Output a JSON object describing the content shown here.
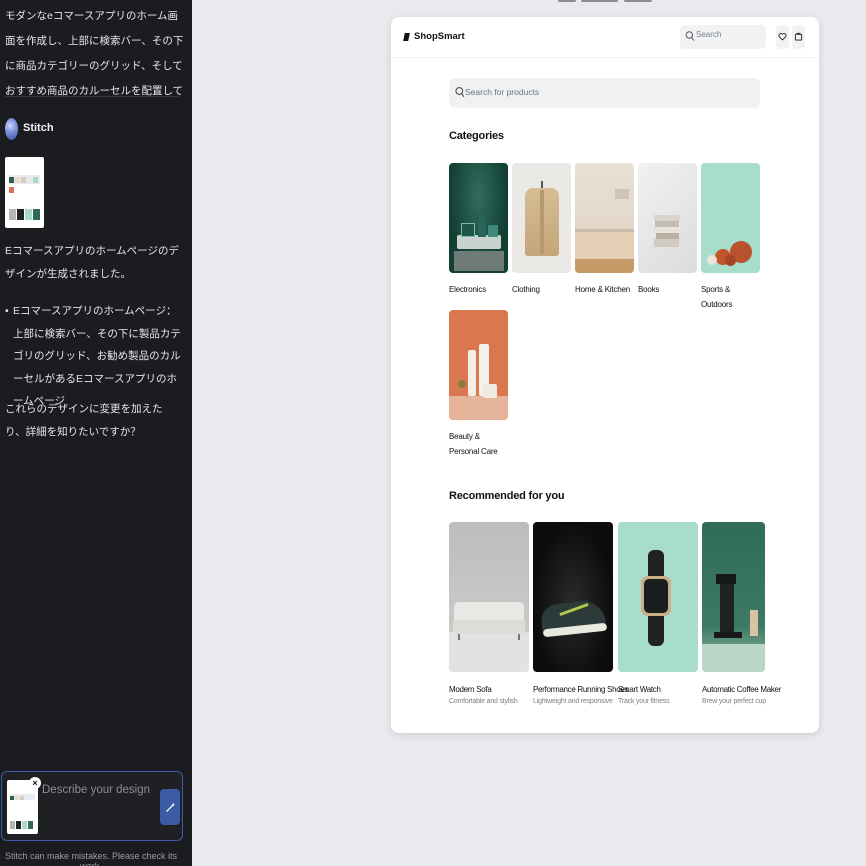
{
  "chat": {
    "prompt": "モダンなeコマースアプリのホーム画面を作成し、上部に検索バー、その下に商品カテゴリーのグリッド、そしておすすめ商品のカルーセルを配置して",
    "agent_name": "Stitch",
    "response_intro": "Eコマースアプリのホームページのデザインが生成されました。",
    "response_item": "Eコマースアプリのホームページ：上部に検索バー、その下に製品カテゴリのグリッド、お勧め製品のカルーセルがあるEコマースアプリのホームページ",
    "response_question": "これらのデザインに変更を加えたり、詳細を知りたいですか？",
    "input_placeholder": "Describe your design",
    "disclaimer": "Stitch can make mistakes. Please check its work."
  },
  "app": {
    "brand": "ShopSmart",
    "header_search_placeholder": "Search",
    "main_search_placeholder": "Search for products",
    "categories_title": "Categories",
    "categories": [
      {
        "label": "Electronics"
      },
      {
        "label": "Clothing"
      },
      {
        "label": "Home & Kitchen"
      },
      {
        "label": "Books"
      },
      {
        "label": "Sports & Outdoors"
      },
      {
        "label": "Beauty & Personal Care"
      }
    ],
    "recommended_title": "Recommended for you",
    "products": [
      {
        "name": "Modern Sofa",
        "desc": "Comfortable and stylish"
      },
      {
        "name": "Performance Running Shoes",
        "desc": "Lightweight and responsive"
      },
      {
        "name": "Smart Watch",
        "desc": "Track your fitness"
      },
      {
        "name": "Automatic Coffee Maker",
        "desc": "Brew your perfect cup"
      }
    ]
  },
  "icons": {
    "header": [
      "search-icon",
      "heart-icon",
      "cart-icon"
    ],
    "composer": [
      "close-icon",
      "magic-wand-icon"
    ]
  }
}
